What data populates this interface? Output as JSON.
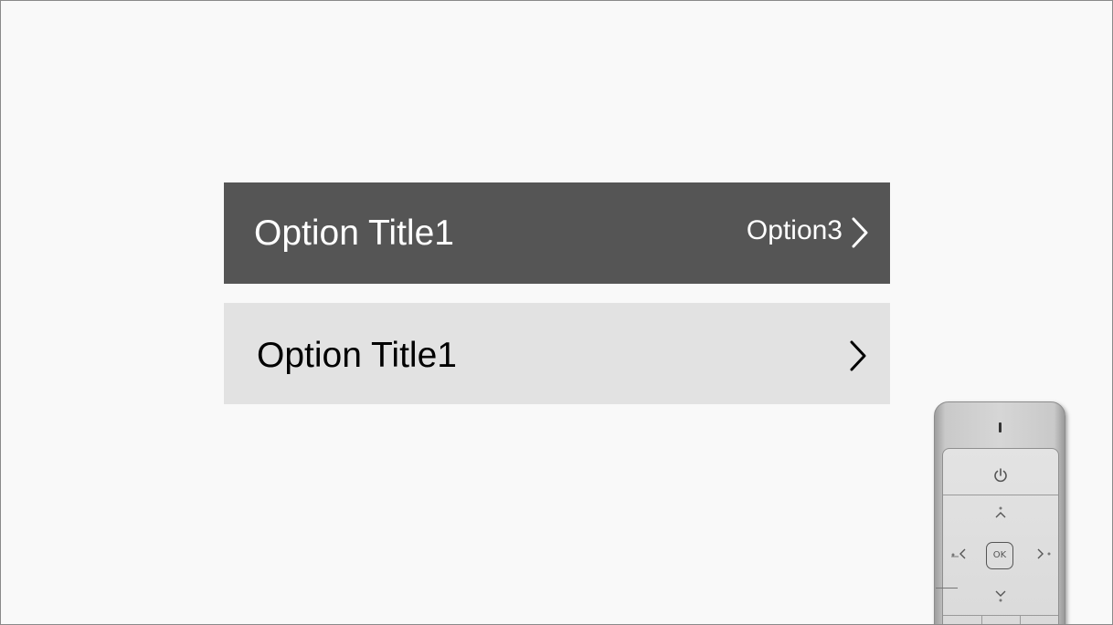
{
  "menu": {
    "rows": [
      {
        "title": "Option Title1",
        "value": "Option3",
        "focused": true
      },
      {
        "title": "Option Title1",
        "value": "",
        "focused": false
      }
    ]
  },
  "remote": {
    "ok_label": "OK"
  },
  "colors": {
    "background": "#f9f9f9",
    "focused_row": "#555555",
    "normal_row": "#e2e2e2",
    "focused_text": "#ffffff",
    "normal_text": "#000000"
  },
  "icons": {
    "chevron": "chevron-right-icon",
    "power": "power-icon",
    "up": "chevron-up-icon",
    "down": "chevron-down-icon",
    "left": "chevron-left-icon",
    "right": "chevron-right-icon"
  }
}
